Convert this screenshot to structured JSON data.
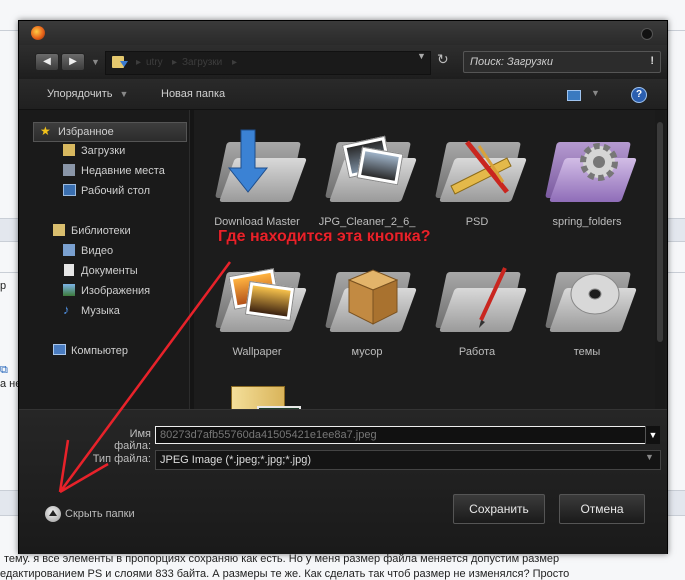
{
  "background_page": {
    "left_fragments": [
      {
        "text": "р"
      },
      {
        "text": "а не"
      }
    ],
    "bottom_text": [
      "тему. я все элементы в пропорциях сохраняю как есть. Но у меня размер файла меняется допустим размер",
      "едактированием PS и слоями 833 байта. А размеры те же. Как сделать так чтоб размер не изменялся? Просто"
    ]
  },
  "dialog": {
    "nav": {
      "back_icon": "back-arrow-icon",
      "forward_icon": "forward-arrow-icon",
      "crumbs": [
        "utry",
        "Загрузки"
      ],
      "search_placeholder": "Поиск: Загрузки",
      "search_icon_glyph": "!"
    },
    "toolbar": {
      "organize_label": "Упорядочить",
      "new_folder_label": "Новая папка",
      "help_glyph": "?"
    },
    "sidebar": {
      "groups": [
        {
          "label": "Избранное",
          "icon": "star-icon",
          "selected": true
        },
        {
          "label": "Загрузки",
          "icon": "downloads-folder-icon",
          "indent": true
        },
        {
          "label": "Недавние места",
          "icon": "recent-places-icon",
          "indent": true
        },
        {
          "label": "Рабочий стол",
          "icon": "desktop-icon",
          "indent": true
        },
        {
          "label": "Библиотеки",
          "icon": "libraries-icon"
        },
        {
          "label": "Видео",
          "icon": "video-icon",
          "indent": true
        },
        {
          "label": "Документы",
          "icon": "documents-icon",
          "indent": true
        },
        {
          "label": "Изображения",
          "icon": "images-icon",
          "indent": true
        },
        {
          "label": "Музыка",
          "icon": "music-icon",
          "indent": true
        },
        {
          "label": "Компьютер",
          "icon": "computer-icon"
        }
      ]
    },
    "files": [
      {
        "name": "Download Master",
        "icon": "download-master-folder-icon"
      },
      {
        "name": "JPG_Cleaner_2_6_",
        "icon": "photo-folder-icon"
      },
      {
        "name": "PSD",
        "icon": "psd-folder-icon"
      },
      {
        "name": "spring_folders",
        "icon": "gear-folder-icon"
      },
      {
        "name": "Wallpaper",
        "icon": "wallpaper-folder-icon"
      },
      {
        "name": "мусор",
        "icon": "crate-folder-icon"
      },
      {
        "name": "Работа",
        "icon": "work-folder-icon"
      },
      {
        "name": "темы",
        "icon": "disc-folder-icon"
      },
      {
        "name": "",
        "icon": "yellow-folder-icon"
      }
    ],
    "bottom": {
      "filename_label": "Имя файла:",
      "filename_value": "80273d7afb55760da41505421e1ee8a7.jpeg",
      "filetype_label": "Тип файла:",
      "filetype_value": "JPEG Image (*.jpeg;*.jpg;*.jpg)",
      "hide_folders_label": "Скрыть папки",
      "save_label": "Сохранить",
      "cancel_label": "Отмена"
    }
  },
  "annotation": {
    "text": "Где находится эта кнопка?",
    "color": "#e8222a"
  }
}
